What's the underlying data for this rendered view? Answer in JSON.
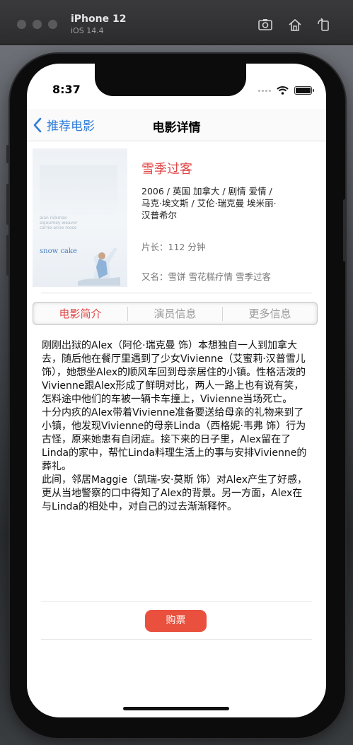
{
  "simulator": {
    "device": "iPhone 12",
    "os": "iOS 14.4"
  },
  "status_bar": {
    "time": "8:37"
  },
  "nav": {
    "back_label": "推荐电影",
    "title": "电影详情"
  },
  "movie": {
    "title": "雪季过客",
    "meta": "2006 / 英国 加拿大 / 剧情 爱情 / 马克·埃文斯 / 艾伦·瑞克曼 埃米丽·汉普希尔",
    "length": "片长：112 分钟",
    "alias": "又名：雪饼 雪花糕疗情 雪季过客",
    "poster": {
      "credits": "alan rickman sigourney weaver carrie-anne moss",
      "logo": "snow cake"
    }
  },
  "tabs": [
    {
      "label": "电影简介",
      "active": true
    },
    {
      "label": "演员信息",
      "active": false
    },
    {
      "label": "更多信息",
      "active": false
    }
  ],
  "synopsis": [
    "刚刚出狱的Alex（阿伦·瑞克曼 饰）本想独自一人到加拿大去，随后他在餐厅里遇到了少女Vivienne（艾蜜莉·汉普雪儿 饰），她想坐Alex的顺风车回到母亲居住的小镇。性格活泼的Vivienne跟Alex形成了鲜明对比，两人一路上也有说有笑，怎料途中他们的车被一辆卡车撞上，Vivienne当场死亡。",
    "十分内疚的Alex带着Vivienne准备要送给母亲的礼物来到了小镇，他发现Vivienne的母亲Linda（西格妮·韦弗 饰）行为古怪，原来她患有自闭症。接下来的日子里，Alex留在了Linda的家中，帮忙Linda料理生活上的事与安排Vivienne的葬礼。",
    "此间，邻居Maggie（凯瑞-安·莫斯 饰）对Alex产生了好感，更从当地警察的口中得知了Alex的背景。另一方面，Alex在与Linda的相处中，对自己的过去渐渐释怀。"
  ],
  "buy_button": "购票",
  "colors": {
    "accent_red": "#e04545",
    "button_red": "#e9503e",
    "link_blue": "#2f7dd8"
  }
}
